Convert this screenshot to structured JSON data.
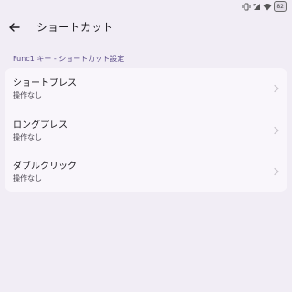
{
  "status_bar": {
    "icons": [
      "vibrate-icon",
      "signal-icon",
      "wifi-icon",
      "battery-icon"
    ],
    "battery_level": "82"
  },
  "app_bar": {
    "back_icon": "arrow-left-icon",
    "title": "ショートカット"
  },
  "section": {
    "header": "Func1 キー - ショートカット設定"
  },
  "items": [
    {
      "title": "ショートプレス",
      "subtitle": "操作なし"
    },
    {
      "title": "ロングプレス",
      "subtitle": "操作なし"
    },
    {
      "title": "ダブルクリック",
      "subtitle": "操作なし"
    }
  ],
  "colors": {
    "background": "#f1edf5",
    "card": "#f9f6fb",
    "section_header": "#5e4f8a",
    "chevron": "#c9c5cc"
  }
}
